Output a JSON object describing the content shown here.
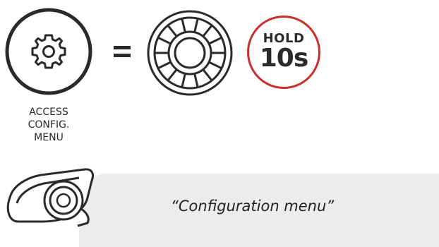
{
  "hold_badge": {
    "line1": "HOLD",
    "line2": "10s"
  },
  "caption": {
    "line1": "ACCESS",
    "line2": "CONFIG.",
    "line3": "MENU"
  },
  "voice_prompt": "“Configuration menu”",
  "icons": {
    "gear": "gear-icon",
    "equals": "equals-icon",
    "jog_dial": "jog-dial-icon",
    "headset": "headset-device-icon"
  },
  "colors": {
    "ink": "#2a2a2a",
    "accent_red": "#c9302c",
    "banner_gray": "#ececec"
  }
}
